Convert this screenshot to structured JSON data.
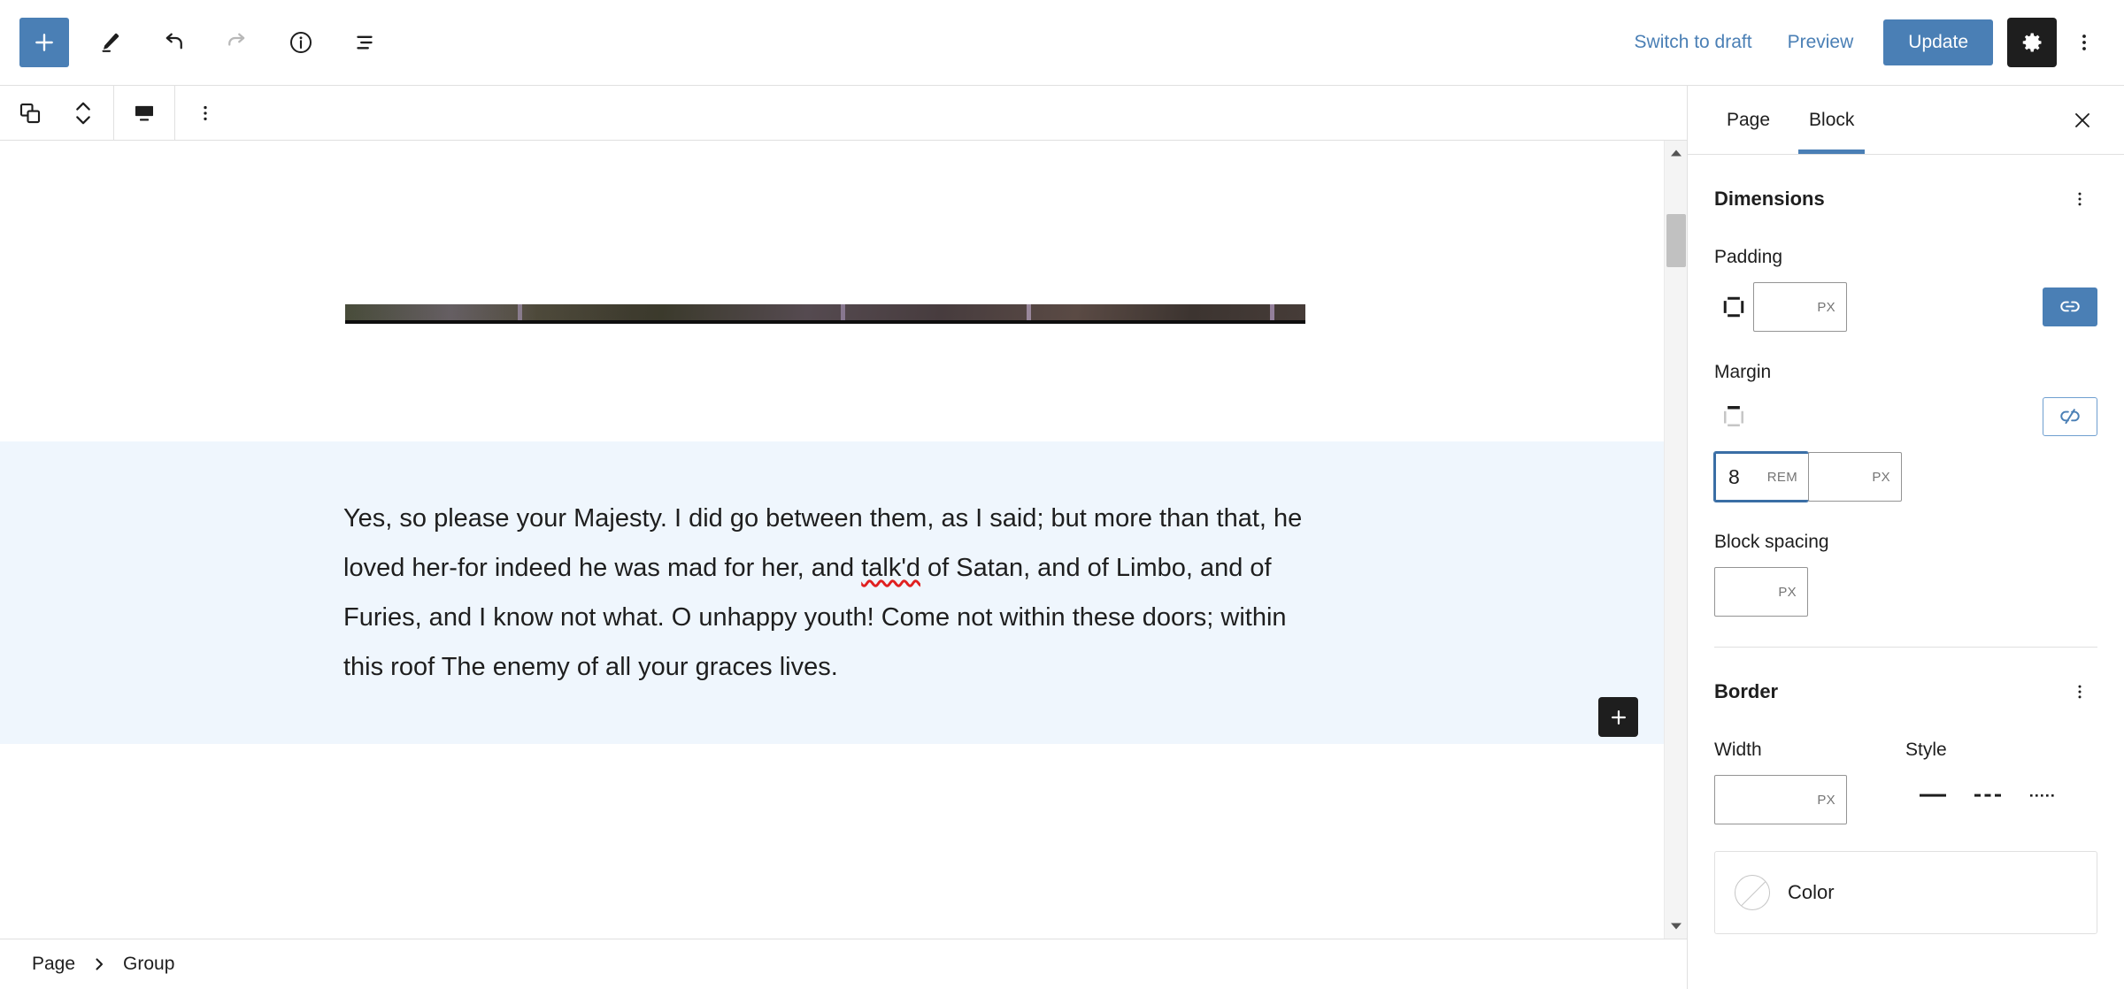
{
  "header": {
    "add_block_label": "+",
    "tools": [
      {
        "name": "edit-tool",
        "label": "Edit"
      },
      {
        "name": "undo",
        "label": "Undo"
      },
      {
        "name": "redo",
        "label": "Redo"
      },
      {
        "name": "details",
        "label": "Details"
      },
      {
        "name": "list-view",
        "label": "List View"
      }
    ],
    "switch_to_draft": "Switch to draft",
    "preview": "Preview",
    "update": "Update",
    "settings_label": "Settings",
    "options_label": "Options"
  },
  "block_toolbar": {
    "transform_label": "Group",
    "movers_label": "Move up or down",
    "align_label": "Align",
    "options_label": "Options"
  },
  "canvas": {
    "paragraph_part1": "Yes, so please your Majesty. I did go between them, as I said; but more than that, he loved her-for indeed he was mad for her, and ",
    "paragraph_misspelled": "talk'd",
    "paragraph_part2": " of Satan, and of Limbo, and of Furies, and I know not what. O unhappy youth! Come not within these doors; within this roof The enemy of all your graces lives.",
    "section_background": "#eff6fd",
    "appender_label": "+"
  },
  "sidebar": {
    "tabs": [
      {
        "label": "Page",
        "active": false
      },
      {
        "label": "Block",
        "active": true
      }
    ],
    "close_label": "Close settings",
    "dimensions": {
      "title": "Dimensions",
      "options_label": "Dimensions options",
      "padding": {
        "label": "Padding",
        "value": "",
        "unit": "PX",
        "link_state": "linked"
      },
      "margin": {
        "label": "Margin",
        "value": "8",
        "unit": "REM",
        "second_value": "",
        "second_unit": "PX",
        "link_state": "unlinked"
      },
      "block_spacing": {
        "label": "Block spacing",
        "value": "",
        "unit": "PX"
      }
    },
    "border": {
      "title": "Border",
      "options_label": "Border options",
      "width_label": "Width",
      "width_value": "",
      "width_unit": "PX",
      "style_label": "Style",
      "styles": [
        {
          "name": "solid"
        },
        {
          "name": "dashed"
        },
        {
          "name": "dotted"
        }
      ],
      "color_label": "Color"
    }
  },
  "footer": {
    "breadcrumb": [
      {
        "label": "Page"
      },
      {
        "label": "Group"
      }
    ],
    "separator": "›"
  },
  "colors": {
    "accent": "#4a7fb5",
    "dark": "#1e1e1e",
    "section_blue": "#eff6fd",
    "border_gray": "#e0e0e0"
  }
}
